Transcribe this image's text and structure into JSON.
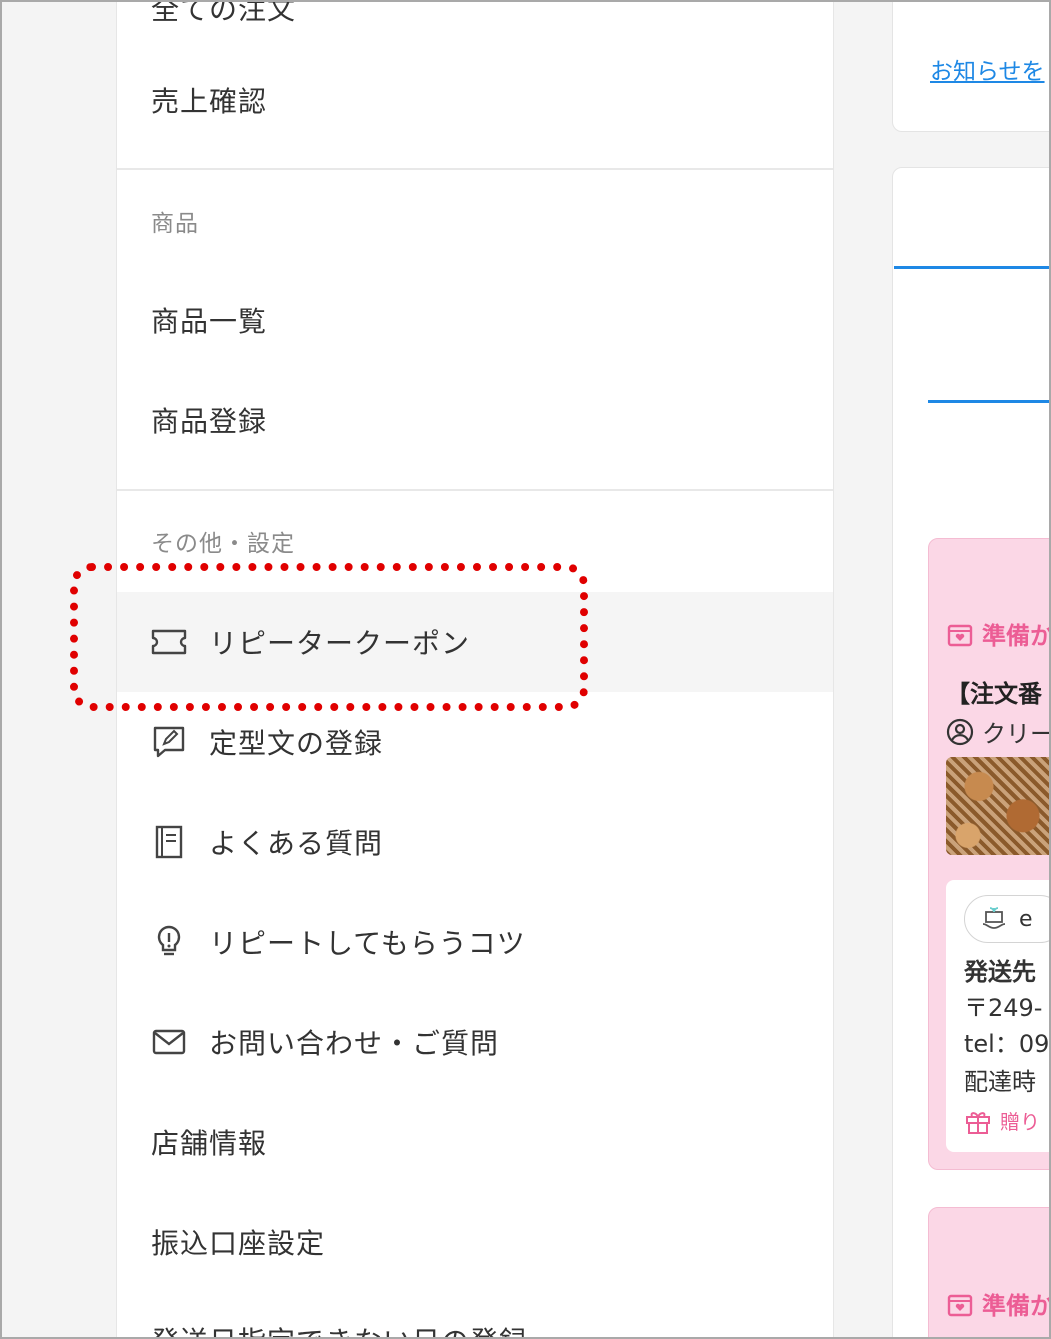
{
  "sidebar": {
    "top_clipped": "全ての注文",
    "sales": "売上確認",
    "section_products": "商品",
    "product_list": "商品一覧",
    "product_register": "商品登録",
    "section_other": "その他・設定",
    "repeater_coupon": "リピータークーポン",
    "template_register": "定型文の登録",
    "faq": "よくある質問",
    "repeat_tips": "リピートしてもらうコツ",
    "contact": "お問い合わせ・ご質問",
    "store_info": "店舗情報",
    "bank_account": "振込口座設定",
    "bottom_clipped": "発送日指定できない日の登録"
  },
  "right": {
    "notice_link": "お知らせを",
    "status_1": "準備か",
    "order_no": "【注文番",
    "creator": "クリー",
    "gift_badge": "e",
    "ship_title": "発送先",
    "ship_zip": "〒249-",
    "ship_tel": "tel：09",
    "ship_time": "配達時",
    "gift_note": "贈り",
    "status_2": "準備か"
  },
  "colors": {
    "accent_blue": "#1e88e5",
    "status_pink": "#ec5d95",
    "card_pink": "#fbd7e6",
    "highlight_red": "#e00000"
  },
  "icons": {
    "repeater_coupon": "ticket-icon",
    "template_register": "chat-edit-icon",
    "faq": "book-icon",
    "repeat_tips": "lightbulb-icon",
    "contact": "mail-icon"
  }
}
